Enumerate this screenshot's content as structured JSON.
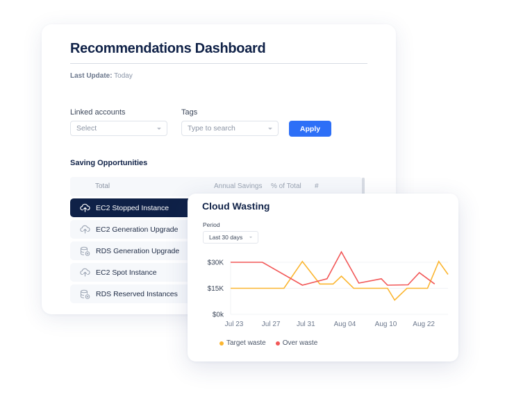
{
  "dashboard": {
    "title": "Recommendations Dashboard",
    "last_update_label": "Last Update:",
    "last_update_value": "Today",
    "filters": {
      "linked_accounts": {
        "label": "Linked accounts",
        "placeholder": "Select"
      },
      "tags": {
        "label": "Tags",
        "placeholder": "Type to search"
      },
      "apply_label": "Apply"
    },
    "section_title": "Saving Opportunities",
    "table": {
      "columns": [
        "Total",
        "Annual Savings",
        "% of Total",
        "#"
      ],
      "rows": [
        {
          "label": "EC2 Stopped Instance",
          "icon": "cloud-upload-icon",
          "active": true
        },
        {
          "label": "EC2 Generation Upgrade",
          "icon": "cloud-upload-icon",
          "active": false
        },
        {
          "label": "RDS Generation Upgrade",
          "icon": "database-add-icon",
          "active": false
        },
        {
          "label": "EC2 Spot Instance",
          "icon": "cloud-upload-icon",
          "active": false
        },
        {
          "label": "RDS Reserved Instances",
          "icon": "database-add-icon",
          "active": false
        }
      ]
    }
  },
  "cloud_wasting": {
    "title": "Cloud Wasting",
    "period_label": "Period",
    "period_value": "Last 30 days"
  },
  "colors": {
    "target": "#fbb52f",
    "over": "#f25757",
    "navy": "#0f2147",
    "accent": "#2d6ff7"
  },
  "chart_data": {
    "type": "line",
    "title": "Cloud Wasting",
    "xlabel": "",
    "ylabel": "",
    "ylim": [
      0,
      30000
    ],
    "yticks": [
      0,
      15000,
      30000
    ],
    "ytick_labels": [
      "$0k",
      "$15K",
      "$30K"
    ],
    "xtick_labels": [
      "Jul 23",
      "Jul 27",
      "Jul 31",
      "Aug 04",
      "Aug 10",
      "Aug 22"
    ],
    "xtick_positions": [
      0,
      3.6,
      7,
      10.8,
      14.8,
      18.5
    ],
    "x_range": [
      0,
      21.2
    ],
    "grid": true,
    "legend_position": "bottom-left",
    "series": [
      {
        "name": "Target waste",
        "color": "#fbb52f",
        "x": [
          0,
          5.2,
          7,
          8.7,
          10,
          10.8,
          12,
          15.3,
          16,
          17.2,
          18.4,
          19.2,
          20.3,
          21.2
        ],
        "values": [
          15000,
          15000,
          30500,
          17500,
          17500,
          22000,
          15000,
          15000,
          8200,
          15000,
          15000,
          15000,
          30500,
          23000
        ]
      },
      {
        "name": "Over waste",
        "color": "#f25757",
        "x": [
          0,
          3.1,
          7,
          9.4,
          10.8,
          12.5,
          14.7,
          15.3,
          17.3,
          18.4,
          19.9
        ],
        "values": [
          30000,
          30000,
          16800,
          20500,
          36000,
          18000,
          20500,
          16800,
          17000,
          24000,
          17500
        ]
      }
    ]
  }
}
